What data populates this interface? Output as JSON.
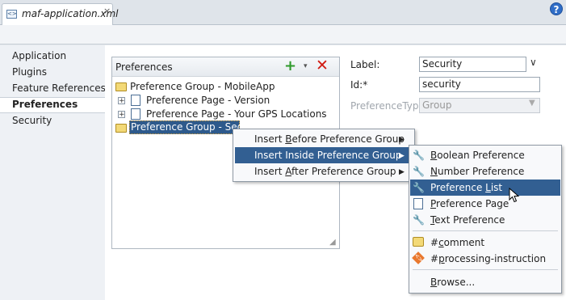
{
  "tab": {
    "title": "maf-application.xml",
    "close": "×"
  },
  "help": "?",
  "nav": {
    "items": [
      "Application",
      "Plugins",
      "Feature References",
      "Preferences",
      "Security"
    ],
    "selected": 3
  },
  "preferences": {
    "title": "Preferences",
    "add": "+",
    "caret": "▾",
    "delete": "✕",
    "tree": {
      "group_mobileapp": "Preference Group - MobileApp",
      "page_version": "Preference Page - Version",
      "page_gps": "Preference Page - Your GPS Locations",
      "group_security": "Preference Group - Security"
    }
  },
  "form": {
    "label_label": "Label:",
    "label_value": "Security",
    "id_label": "Id:*",
    "id_value": "security",
    "type_label": "PreferenceType:",
    "type_value": "Group"
  },
  "context_menu": {
    "items": [
      {
        "pre": "Insert ",
        "mn": "B",
        "post": "efore Preference Group",
        "arrow": "▶"
      },
      {
        "pre": "Insert Inside Preference Group",
        "mn": "",
        "post": "",
        "arrow": "▶"
      },
      {
        "pre": "Insert ",
        "mn": "A",
        "post": "fter Preference Group",
        "arrow": "▶"
      }
    ]
  },
  "submenu": {
    "items": [
      {
        "pre": "",
        "mn": "B",
        "post": "oolean Preference",
        "icon": "wrench-icon"
      },
      {
        "pre": "",
        "mn": "N",
        "post": "umber Preference",
        "icon": "wrench-icon"
      },
      {
        "pre": "Preference ",
        "mn": "L",
        "post": "ist",
        "icon": "wrench-icon"
      },
      {
        "pre": "",
        "mn": "P",
        "post": "reference Page",
        "icon": "page-icon"
      },
      {
        "pre": "",
        "mn": "T",
        "post": "ext Preference",
        "icon": "wrench-icon"
      },
      {
        "pre": "#",
        "mn": "c",
        "post": "omment",
        "icon": "comment-icon"
      },
      {
        "pre": "#",
        "mn": "p",
        "post": "rocessing-instruction",
        "icon": "processing-icon"
      },
      {
        "pre": "",
        "mn": "B",
        "post": "rowse...",
        "icon": ""
      }
    ]
  },
  "colors": {
    "highlight": "#325f92",
    "add": "#2f9a2b",
    "delete": "#d11b12"
  }
}
